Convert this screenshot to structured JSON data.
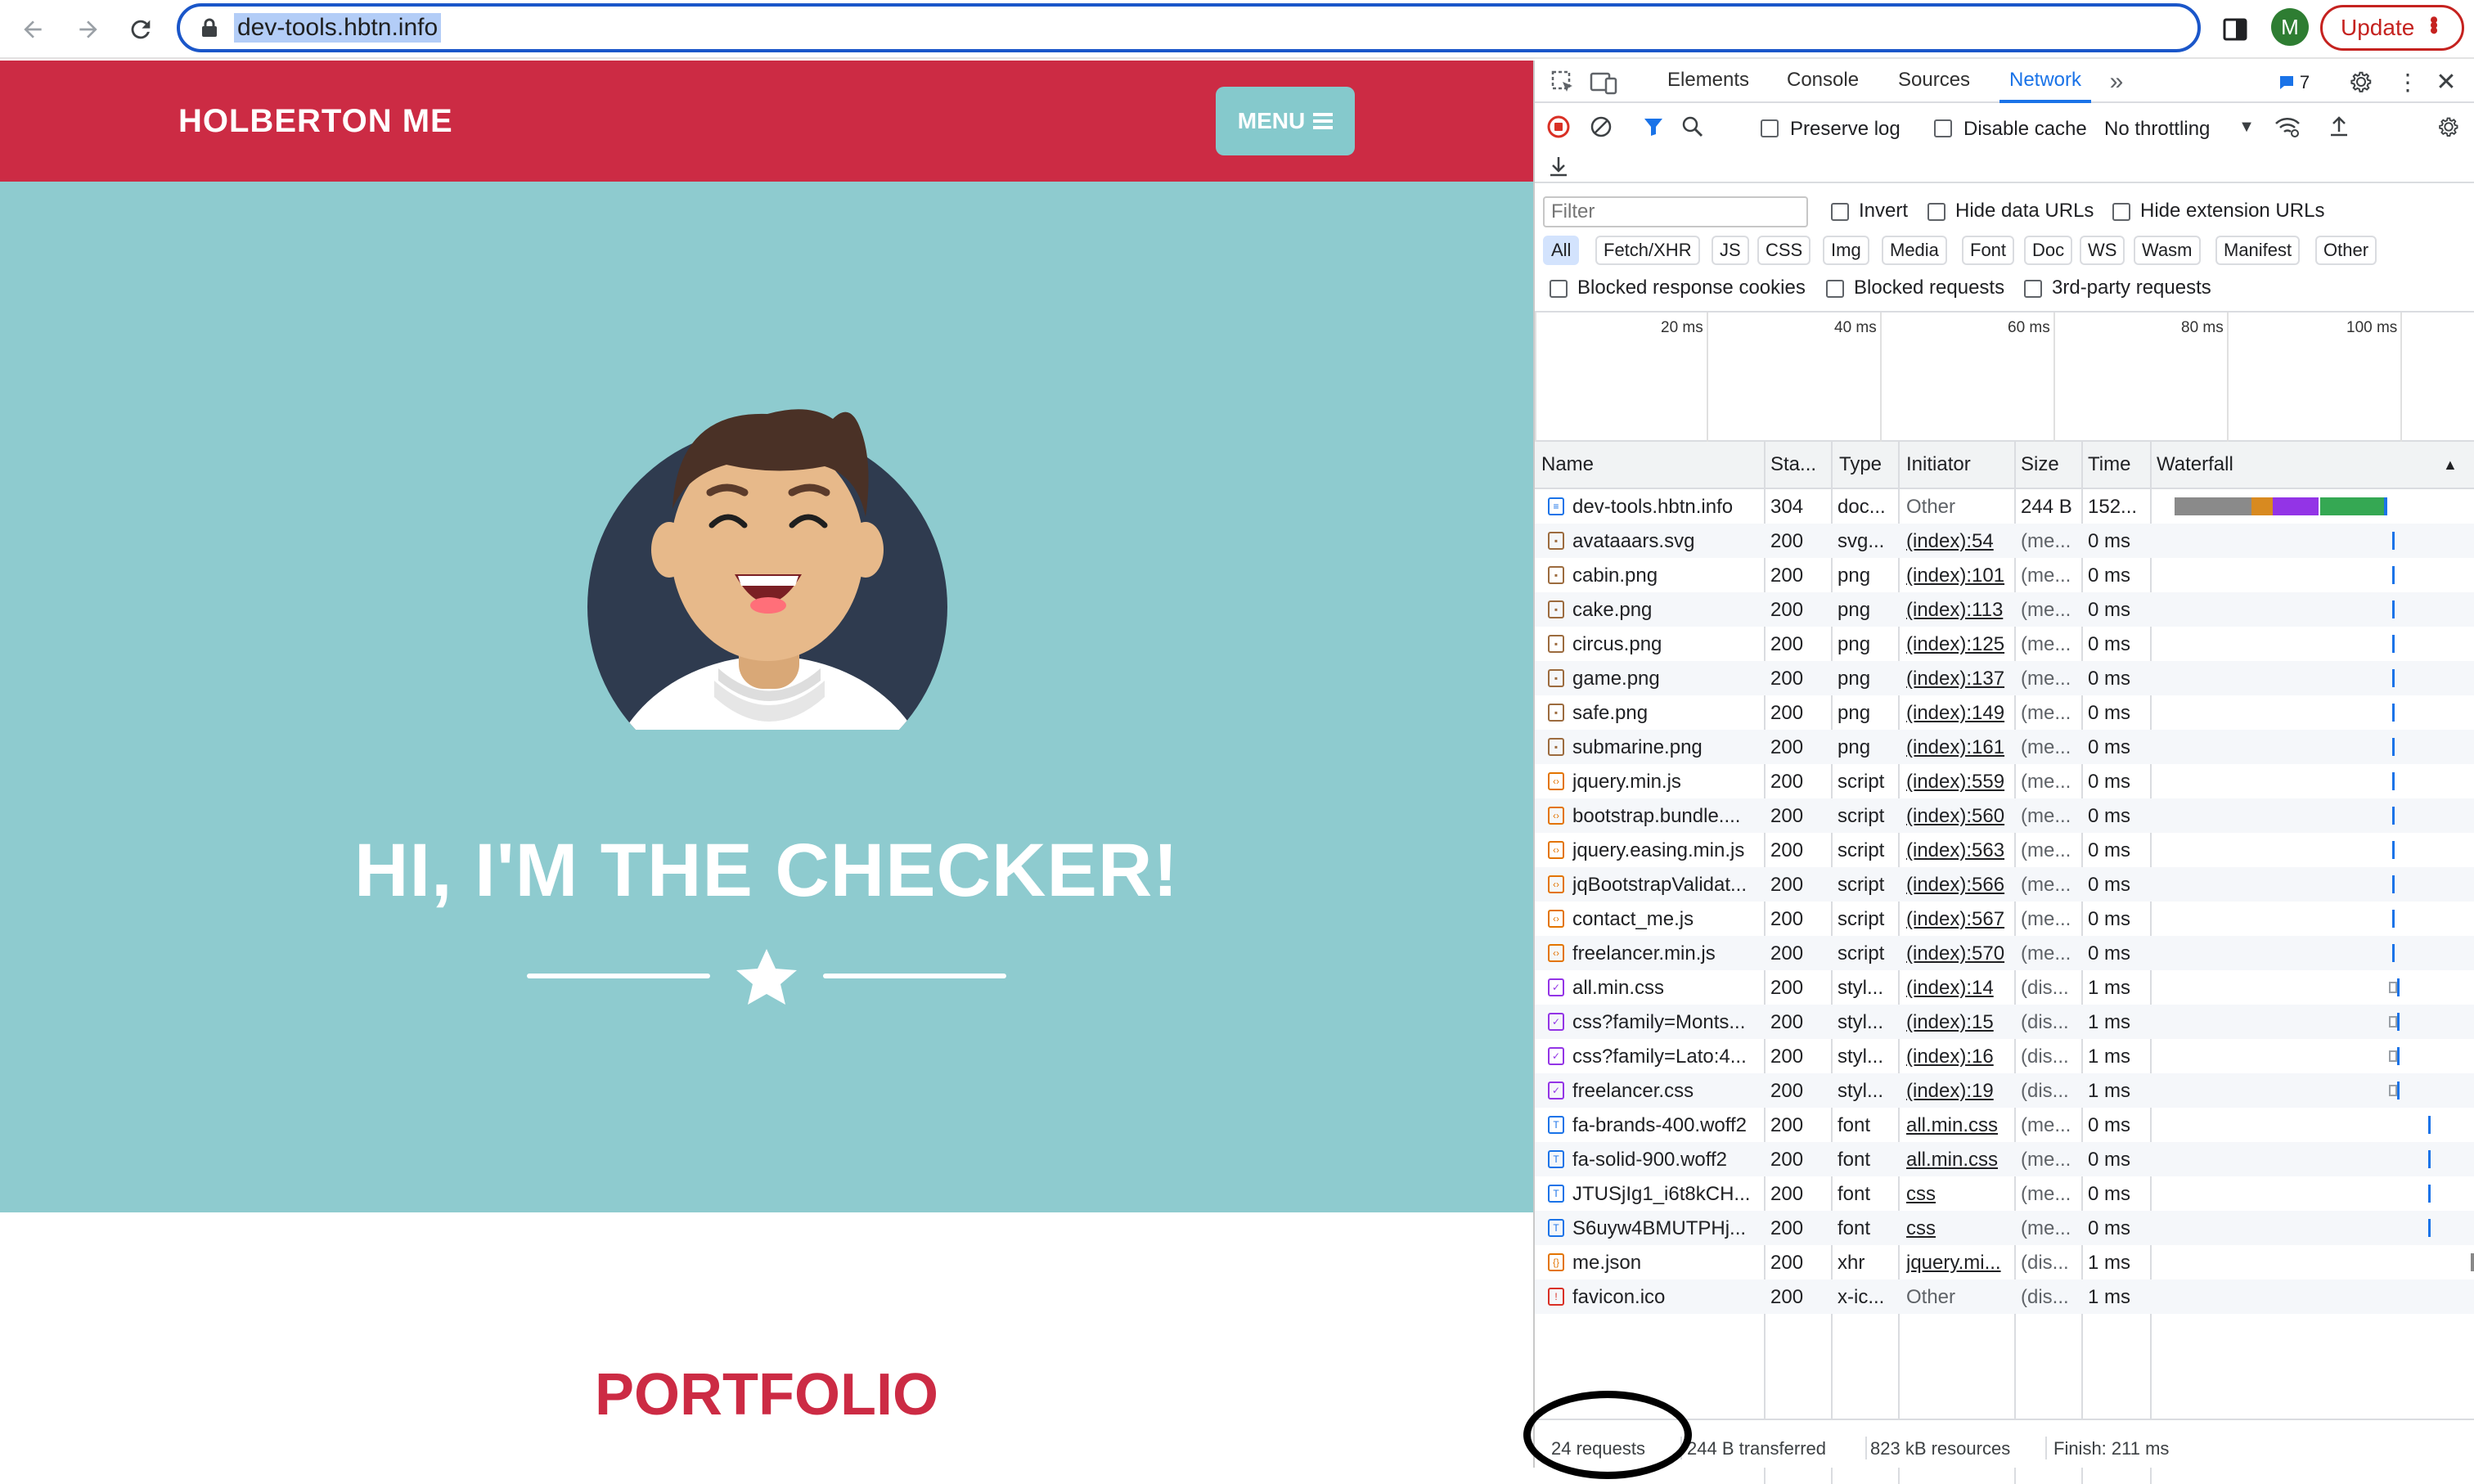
{
  "browser": {
    "url": "dev-tools.hbtn.info",
    "profile_initial": "M",
    "update_label": "Update",
    "icons": [
      "back-icon",
      "forward-icon",
      "reload-icon",
      "lock-icon",
      "share-icon",
      "bookmark-star-icon",
      "side-panel-icon",
      "kebab-menu-icon"
    ]
  },
  "page": {
    "brand": "HOLBERTON ME",
    "menu_label": "MENU",
    "hero_title": "HI, I'M THE CHECKER!",
    "portfolio_title": "PORTFOLIO",
    "colors": {
      "nav": "#cc2b44",
      "hero": "#8ecbcf",
      "menu_button": "#85c9cc"
    }
  },
  "devtools": {
    "tabs": [
      "Elements",
      "Console",
      "Sources",
      "Network"
    ],
    "active_tab": "Network",
    "issues_count": "7",
    "preserve_log": "Preserve log",
    "disable_cache": "Disable cache",
    "throttling": "No throttling",
    "filter_placeholder": "Filter",
    "invert": "Invert",
    "hide_data_urls": "Hide data URLs",
    "hide_extension_urls": "Hide extension URLs",
    "type_filters": [
      "All",
      "Fetch/XHR",
      "JS",
      "CSS",
      "Img",
      "Media",
      "Font",
      "Doc",
      "WS",
      "Wasm",
      "Manifest",
      "Other"
    ],
    "blocked_cookies": "Blocked response cookies",
    "blocked_requests": "Blocked requests",
    "third_party": "3rd-party requests",
    "timeline_ticks": [
      "20 ms",
      "40 ms",
      "60 ms",
      "80 ms",
      "100 ms"
    ],
    "columns": [
      "Name",
      "Sta...",
      "Type",
      "Initiator",
      "Size",
      "Time",
      "Waterfall"
    ],
    "requests": [
      {
        "name": "dev-tools.hbtn.info",
        "status": "304",
        "type": "doc...",
        "initiator": "Other",
        "size": "244 B",
        "time": "152...",
        "icon": "doc-icon",
        "link": false
      },
      {
        "name": "avataaars.svg",
        "status": "200",
        "type": "svg...",
        "initiator": "(index):54",
        "size": "(me...",
        "time": "0 ms",
        "icon": "image-icon",
        "link": true
      },
      {
        "name": "cabin.png",
        "status": "200",
        "type": "png",
        "initiator": "(index):101",
        "size": "(me...",
        "time": "0 ms",
        "icon": "image-icon",
        "link": true
      },
      {
        "name": "cake.png",
        "status": "200",
        "type": "png",
        "initiator": "(index):113",
        "size": "(me...",
        "time": "0 ms",
        "icon": "image-icon",
        "link": true
      },
      {
        "name": "circus.png",
        "status": "200",
        "type": "png",
        "initiator": "(index):125",
        "size": "(me...",
        "time": "0 ms",
        "icon": "image-icon",
        "link": true
      },
      {
        "name": "game.png",
        "status": "200",
        "type": "png",
        "initiator": "(index):137",
        "size": "(me...",
        "time": "0 ms",
        "icon": "image-icon",
        "link": true
      },
      {
        "name": "safe.png",
        "status": "200",
        "type": "png",
        "initiator": "(index):149",
        "size": "(me...",
        "time": "0 ms",
        "icon": "image-icon",
        "link": true
      },
      {
        "name": "submarine.png",
        "status": "200",
        "type": "png",
        "initiator": "(index):161",
        "size": "(me...",
        "time": "0 ms",
        "icon": "image-icon",
        "link": true
      },
      {
        "name": "jquery.min.js",
        "status": "200",
        "type": "script",
        "initiator": "(index):559",
        "size": "(me...",
        "time": "0 ms",
        "icon": "script-icon",
        "link": true
      },
      {
        "name": "bootstrap.bundle....",
        "status": "200",
        "type": "script",
        "initiator": "(index):560",
        "size": "(me...",
        "time": "0 ms",
        "icon": "script-icon",
        "link": true
      },
      {
        "name": "jquery.easing.min.js",
        "status": "200",
        "type": "script",
        "initiator": "(index):563",
        "size": "(me...",
        "time": "0 ms",
        "icon": "script-icon",
        "link": true
      },
      {
        "name": "jqBootstrapValidat...",
        "status": "200",
        "type": "script",
        "initiator": "(index):566",
        "size": "(me...",
        "time": "0 ms",
        "icon": "script-icon",
        "link": true
      },
      {
        "name": "contact_me.js",
        "status": "200",
        "type": "script",
        "initiator": "(index):567",
        "size": "(me...",
        "time": "0 ms",
        "icon": "script-icon",
        "link": true
      },
      {
        "name": "freelancer.min.js",
        "status": "200",
        "type": "script",
        "initiator": "(index):570",
        "size": "(me...",
        "time": "0 ms",
        "icon": "script-icon",
        "link": true
      },
      {
        "name": "all.min.css",
        "status": "200",
        "type": "styl...",
        "initiator": "(index):14",
        "size": "(dis...",
        "time": "1 ms",
        "icon": "stylesheet-icon",
        "link": true
      },
      {
        "name": "css?family=Monts...",
        "status": "200",
        "type": "styl...",
        "initiator": "(index):15",
        "size": "(dis...",
        "time": "1 ms",
        "icon": "stylesheet-icon",
        "link": true
      },
      {
        "name": "css?family=Lato:4...",
        "status": "200",
        "type": "styl...",
        "initiator": "(index):16",
        "size": "(dis...",
        "time": "1 ms",
        "icon": "stylesheet-icon",
        "link": true
      },
      {
        "name": "freelancer.css",
        "status": "200",
        "type": "styl...",
        "initiator": "(index):19",
        "size": "(dis...",
        "time": "1 ms",
        "icon": "stylesheet-icon",
        "link": true
      },
      {
        "name": "fa-brands-400.woff2",
        "status": "200",
        "type": "font",
        "initiator": "all.min.css",
        "size": "(me...",
        "time": "0 ms",
        "icon": "font-icon",
        "link": true
      },
      {
        "name": "fa-solid-900.woff2",
        "status": "200",
        "type": "font",
        "initiator": "all.min.css",
        "size": "(me...",
        "time": "0 ms",
        "icon": "font-icon",
        "link": true
      },
      {
        "name": "JTUSjIg1_i6t8kCH...",
        "status": "200",
        "type": "font",
        "initiator": "css",
        "size": "(me...",
        "time": "0 ms",
        "icon": "font-icon",
        "link": true
      },
      {
        "name": "S6uyw4BMUTPHj...",
        "status": "200",
        "type": "font",
        "initiator": "css",
        "size": "(me...",
        "time": "0 ms",
        "icon": "font-icon",
        "link": true
      },
      {
        "name": "me.json",
        "status": "200",
        "type": "xhr",
        "initiator": "jquery.mi...",
        "size": "(dis...",
        "time": "1 ms",
        "icon": "json-icon",
        "link": true
      },
      {
        "name": "favicon.ico",
        "status": "200",
        "type": "x-ic...",
        "initiator": "Other",
        "size": "(dis...",
        "time": "1 ms",
        "icon": "favicon-icon",
        "link": false
      }
    ],
    "status_bar": {
      "requests": "24 requests",
      "transferred": "244 B transferred",
      "resources": "823 kB resources",
      "finish": "Finish: 211 ms"
    }
  }
}
